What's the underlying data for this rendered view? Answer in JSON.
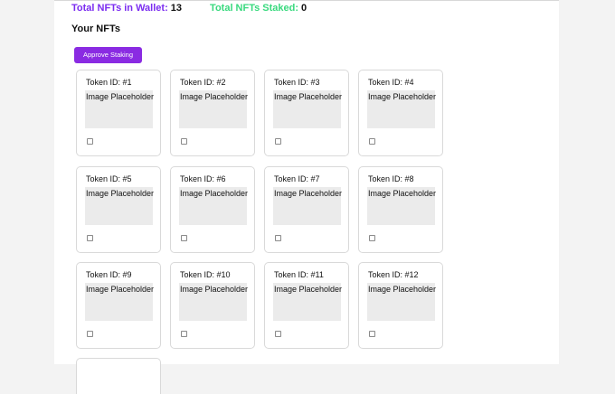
{
  "stats": {
    "wallet_label": "Total NFTs in Wallet:",
    "wallet_count": "13",
    "staked_label": "Total NFTs Staked:",
    "staked_count": "0"
  },
  "section_title": "Your NFTs",
  "approve_label": "Approve Staking",
  "image_placeholder_text": "Image Placeholder",
  "nfts": [
    {
      "label": "Token ID: #1",
      "checked": false
    },
    {
      "label": "Token ID: #2",
      "checked": false
    },
    {
      "label": "Token ID: #3",
      "checked": false
    },
    {
      "label": "Token ID: #4",
      "checked": false
    },
    {
      "label": "Token ID: #5",
      "checked": false
    },
    {
      "label": "Token ID: #6",
      "checked": false
    },
    {
      "label": "Token ID: #7",
      "checked": false
    },
    {
      "label": "Token ID: #8",
      "checked": false
    },
    {
      "label": "Token ID: #9",
      "checked": false
    },
    {
      "label": "Token ID: #10",
      "checked": false
    },
    {
      "label": "Token ID: #11",
      "checked": false
    },
    {
      "label": "Token ID: #12",
      "checked": false
    }
  ],
  "colors": {
    "accent_purple": "#8a2be2",
    "wallet_label": "#7b2cf0",
    "staked_label": "#39d97e",
    "placeholder_bg": "#ebebeb"
  }
}
